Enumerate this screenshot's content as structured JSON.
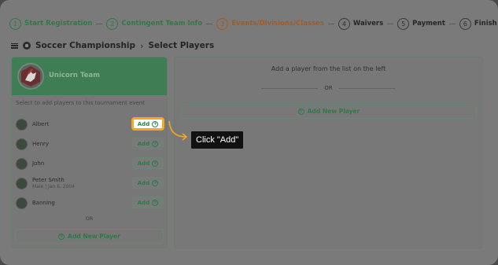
{
  "stepper": {
    "steps": [
      {
        "num": "1",
        "label": "Start Registration"
      },
      {
        "num": "2",
        "label": "Contingent Team Info"
      },
      {
        "num": "3",
        "label": "Events/Divisions/Classes"
      },
      {
        "num": "4",
        "label": "Waivers"
      },
      {
        "num": "5",
        "label": "Payment"
      },
      {
        "num": "6",
        "label": "Finish"
      }
    ]
  },
  "breadcrumb": {
    "event": "Soccer Championship",
    "separator": "›",
    "page": "Select Players"
  },
  "left_panel": {
    "team_name": "Unicorn Team",
    "hint": "Select to add players to this tournament event",
    "add_label": "Add",
    "players": [
      {
        "name": "Albert",
        "sub": ""
      },
      {
        "name": "Henry",
        "sub": ""
      },
      {
        "name": "John",
        "sub": ""
      },
      {
        "name": "Peter Smith",
        "sub": "Male | Jan 6, 2004"
      },
      {
        "name": "Banning",
        "sub": ""
      }
    ],
    "or_text": "OR",
    "add_new_label": "Add New Player"
  },
  "right_panel": {
    "prompt": "Add a player from the list on the left",
    "or_text": "OR",
    "add_new_label": "Add New Player"
  },
  "tooltip": {
    "text": "Click \"Add\""
  },
  "colors": {
    "brand_green": "#2d7a48",
    "active_step": "#a65a22",
    "highlight_border": "#f5a623",
    "tooltip_bg": "#111111"
  },
  "icons": [
    "menu-icon",
    "soccer-ball-icon",
    "plus-circle-icon",
    "team-logo",
    "avatar"
  ]
}
